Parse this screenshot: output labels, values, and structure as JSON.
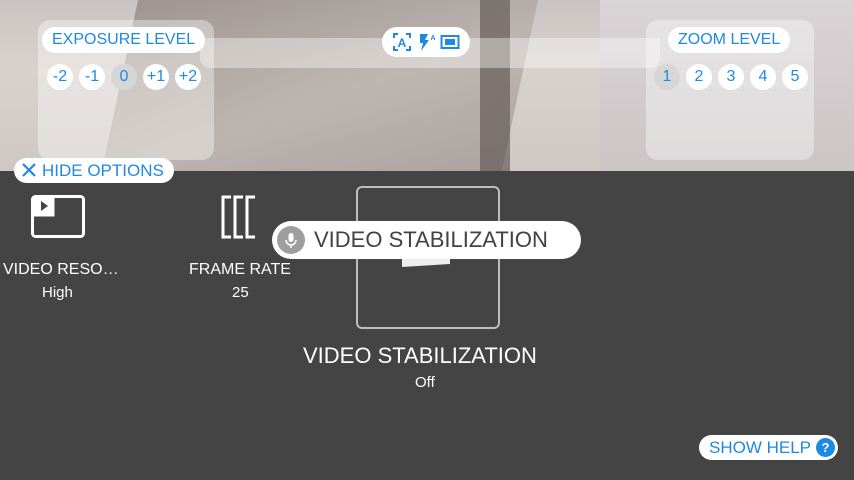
{
  "colors": {
    "accent": "#1e88e5",
    "panel_bg": "#444444",
    "selected_bg": "#d6d6d6"
  },
  "exposure": {
    "label": "EXPOSURE LEVEL",
    "levels": [
      "-2",
      "-1",
      "0",
      "+1",
      "+2"
    ],
    "selected": "0"
  },
  "mode_icons": [
    "auto-focus-icon",
    "flash-auto-icon",
    "aspect-ratio-icon"
  ],
  "zoom": {
    "label": "ZOOM LEVEL",
    "levels": [
      "1",
      "2",
      "3",
      "4",
      "5"
    ],
    "selected": "1"
  },
  "hide_options_label": "HIDE OPTIONS",
  "options": {
    "resolution": {
      "label": "VIDEO RESO…",
      "value": "High",
      "icon": "video-resolution-icon"
    },
    "frame_rate": {
      "label": "FRAME RATE",
      "value": "25",
      "icon": "frame-rate-icon"
    },
    "stabilization": {
      "label": "VIDEO STABILIZATION",
      "value": "Off",
      "icon": "video-stabilization-icon"
    }
  },
  "voice_chip": {
    "text": "VIDEO STABILIZATION",
    "icon": "mic-icon"
  },
  "show_help_label": "SHOW HELP",
  "help_icon_glyph": "?"
}
